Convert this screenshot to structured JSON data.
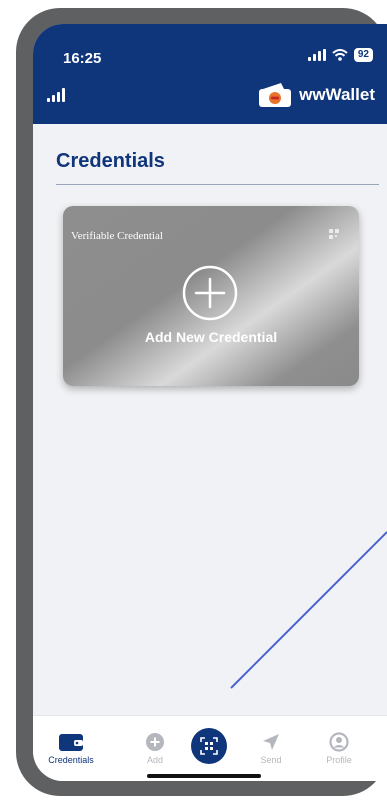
{
  "status_bar": {
    "time": "16:25",
    "battery": "92"
  },
  "header": {
    "app_name": "wwWallet"
  },
  "page": {
    "title": "Credentials"
  },
  "card": {
    "label": "Verifiable Credential",
    "add_label": "Add New Credential"
  },
  "bottom_nav": {
    "items": [
      {
        "label": "Credentials",
        "icon": "wallet-icon",
        "active": true
      },
      {
        "label": "Add",
        "icon": "plus-circle-icon",
        "active": false
      },
      {
        "label": "",
        "icon": "qr-scan-icon",
        "active": false
      },
      {
        "label": "Send",
        "icon": "send-icon",
        "active": false
      },
      {
        "label": "Profile",
        "icon": "profile-icon",
        "active": false
      }
    ]
  },
  "colors": {
    "primary": "#0f357b",
    "background": "#f1f2f5",
    "inactive": "#b4b7be",
    "frame": "#5f6062",
    "annotation": "#4a63d4"
  }
}
